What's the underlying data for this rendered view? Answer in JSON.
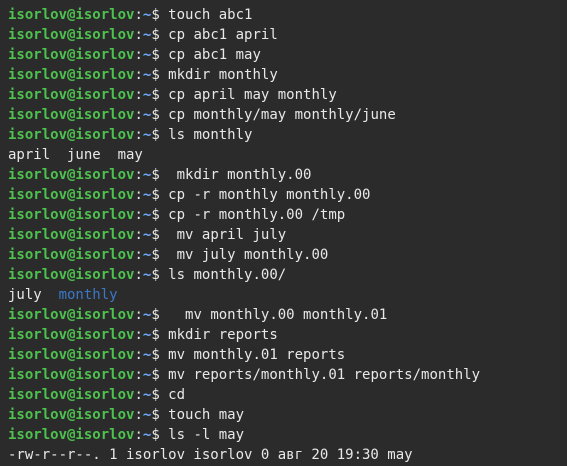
{
  "colors": {
    "background": "#2b2b2b",
    "text": "#e8e8e8",
    "prompt_user": "#4ec24e",
    "prompt_path": "#6ea8ff",
    "directory": "#3b78c7"
  },
  "prompt": {
    "user_host": "isorlov@isorlov",
    "separator": ":",
    "path": "~",
    "symbol": "$"
  },
  "lines": [
    {
      "type": "cmd",
      "text": " touch abc1"
    },
    {
      "type": "cmd",
      "text": " cp abc1 april"
    },
    {
      "type": "cmd",
      "text": " cp abc1 may"
    },
    {
      "type": "cmd",
      "text": " mkdir monthly"
    },
    {
      "type": "cmd",
      "text": " cp april may monthly"
    },
    {
      "type": "cmd",
      "text": " cp monthly/may monthly/june"
    },
    {
      "type": "cmd",
      "text": " ls monthly"
    },
    {
      "type": "out",
      "segments": [
        {
          "text": "april  june  may",
          "kind": "file"
        }
      ]
    },
    {
      "type": "cmd",
      "text": "  mkdir monthly.00"
    },
    {
      "type": "cmd",
      "text": " cp -r monthly monthly.00"
    },
    {
      "type": "cmd",
      "text": " cp -r monthly.00 /tmp"
    },
    {
      "type": "cmd",
      "text": "  mv april july"
    },
    {
      "type": "cmd",
      "text": "  mv july monthly.00"
    },
    {
      "type": "cmd",
      "text": " ls monthly.00/"
    },
    {
      "type": "out",
      "segments": [
        {
          "text": "july  ",
          "kind": "file"
        },
        {
          "text": "monthly",
          "kind": "dir"
        }
      ]
    },
    {
      "type": "cmd",
      "text": "   mv monthly.00 monthly.01"
    },
    {
      "type": "cmd",
      "text": " mkdir reports"
    },
    {
      "type": "cmd",
      "text": " mv monthly.01 reports"
    },
    {
      "type": "cmd",
      "text": " mv reports/monthly.01 reports/monthly"
    },
    {
      "type": "cmd",
      "text": " cd"
    },
    {
      "type": "cmd",
      "text": " touch may"
    },
    {
      "type": "cmd",
      "text": " ls -l may"
    },
    {
      "type": "out",
      "segments": [
        {
          "text": "-rw-r--r--. 1 isorlov isorlov 0 авг 20 19:30 may",
          "kind": "file"
        }
      ]
    }
  ]
}
